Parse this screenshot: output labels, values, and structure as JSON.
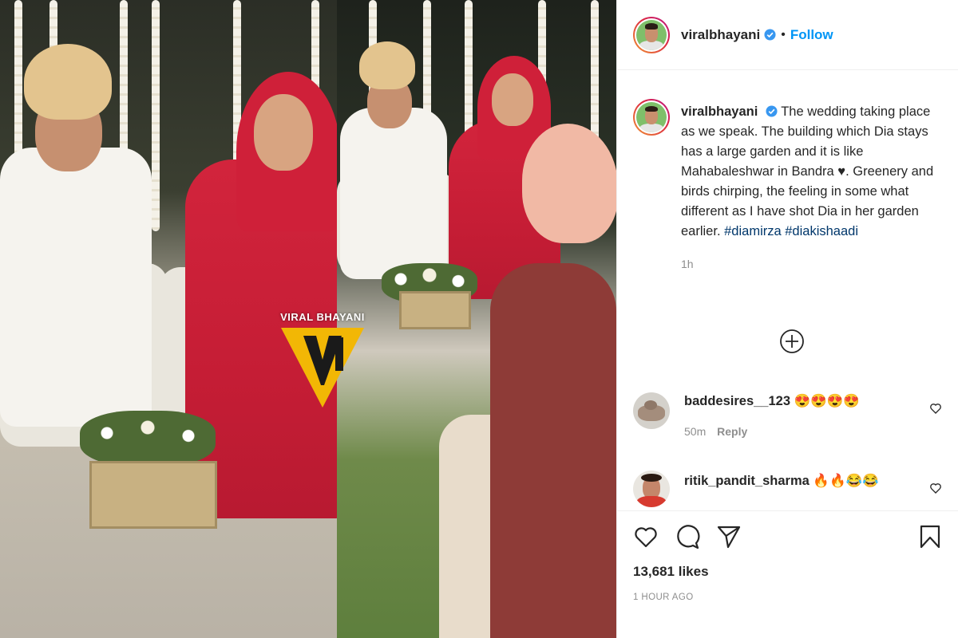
{
  "post": {
    "username": "viralbhayani",
    "follow_label": "Follow",
    "dot": "•",
    "watermark": "VIRAL BHAYANI",
    "caption_part1": "The wedding taking place as we speak. The building which Dia stays has a large garden and it is like Mahabaleshwar in Bandra ♥. Greenery and birds chirping, the feeling in some what different as I have shot Dia in her garden earlier.",
    "hashtags": [
      "#diamirza",
      "#diakishaadi"
    ],
    "caption_time": "1h",
    "likes": "13,681 likes",
    "posted_ago": "1 HOUR AGO"
  },
  "comments": [
    {
      "user": "baddesires__123",
      "text": "😍😍😍😍",
      "time": "50m",
      "reply_label": "Reply"
    },
    {
      "user": "ritik_pandit_sharma",
      "text": "🔥🔥😂😂"
    }
  ],
  "icons": {
    "verified": "verified-badge-icon",
    "load_more": "plus-circle-icon",
    "like": "heart-icon",
    "comment": "comment-icon",
    "share": "paper-plane-icon",
    "save": "bookmark-icon"
  },
  "colors": {
    "follow_blue": "#0095f6",
    "hashtag_blue": "#00376b",
    "muted_gray": "#8e8e8e"
  }
}
